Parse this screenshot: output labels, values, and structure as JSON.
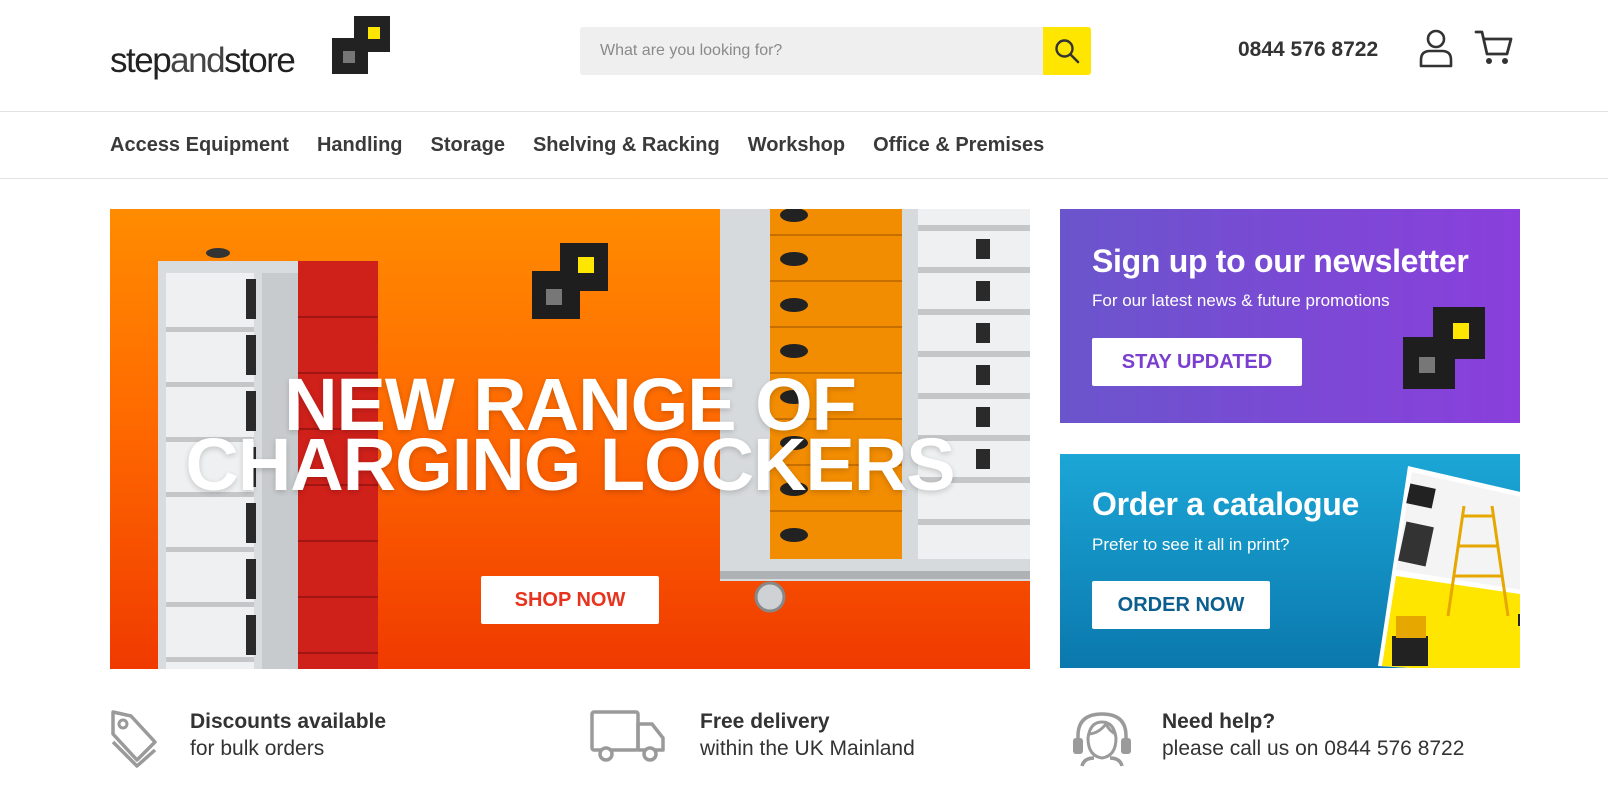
{
  "header": {
    "logo": {
      "part1": "step",
      "part2": "and",
      "part3": "store"
    },
    "search": {
      "placeholder": "What are you looking for?"
    },
    "phone": "0844 576 8722",
    "colors": {
      "accent": "#ffe600",
      "logo_dark": "#222222"
    }
  },
  "nav": {
    "items": [
      {
        "label": "Access Equipment"
      },
      {
        "label": "Handling"
      },
      {
        "label": "Storage"
      },
      {
        "label": "Shelving & Racking"
      },
      {
        "label": "Workshop"
      },
      {
        "label": "Office & Premises"
      }
    ]
  },
  "hero": {
    "title_line1": "NEW RANGE OF",
    "title_line2": "CHARGING LOCKERS",
    "button": "SHOP NOW",
    "colors": {
      "gradient_top": "#ff8c00",
      "gradient_bottom": "#f03a00",
      "button_text": "#e8331e"
    }
  },
  "promos": {
    "newsletter": {
      "title": "Sign up to our newsletter",
      "subtitle": "For our latest news & future promotions",
      "button": "STAY UPDATED",
      "colors": {
        "bg_start": "#6a55cc",
        "bg_end": "#8a3fdc"
      }
    },
    "catalogue": {
      "title": "Order a catalogue",
      "subtitle": "Prefer to see it all in print?",
      "button": "ORDER NOW",
      "colors": {
        "bg_start": "#1ba6d6",
        "bg_end": "#0b78ad"
      }
    }
  },
  "usps": [
    {
      "icon": "price-tag-icon",
      "title": "Discounts available",
      "text": "for bulk orders"
    },
    {
      "icon": "delivery-truck-icon",
      "title": "Free delivery",
      "text": "within the UK Mainland"
    },
    {
      "icon": "support-headset-icon",
      "title": "Need help?",
      "text": "please call us on 0844 576 8722"
    }
  ]
}
